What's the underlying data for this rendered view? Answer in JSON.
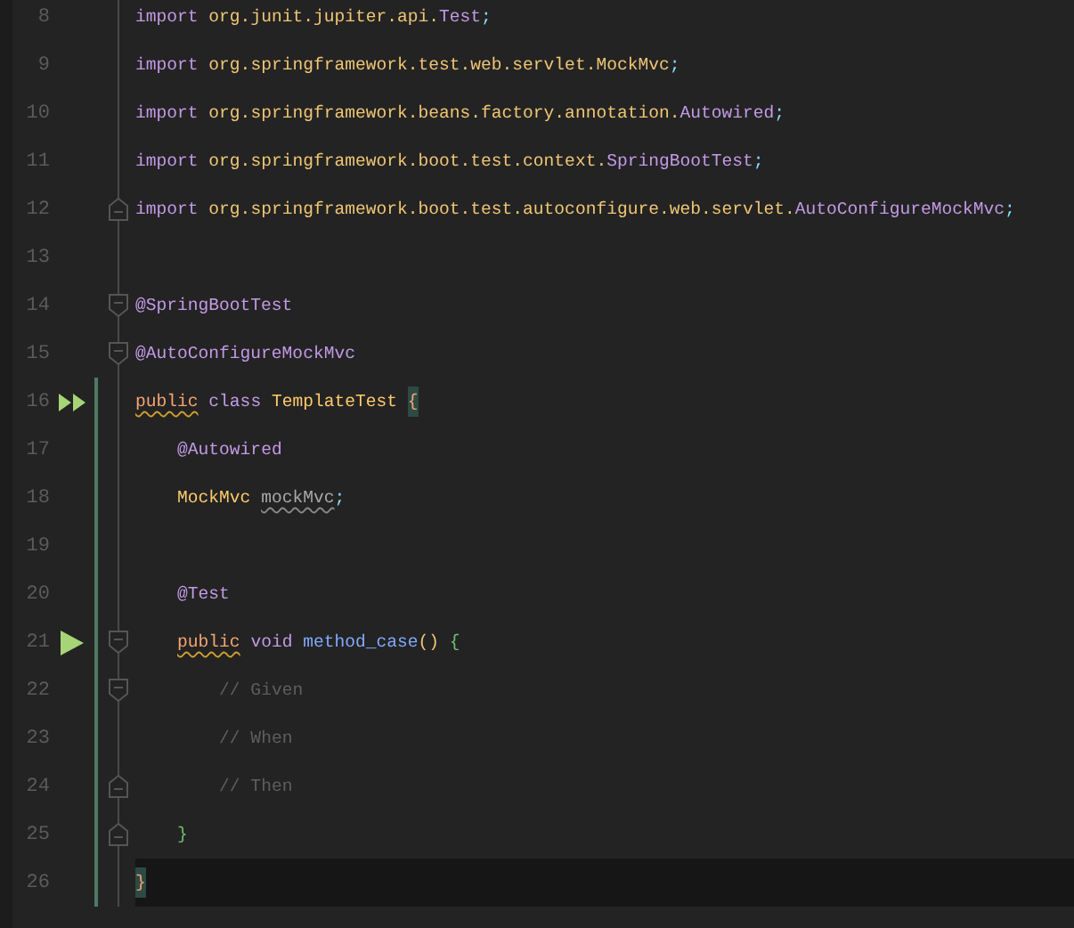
{
  "lines": [
    {
      "number": "8",
      "current": false,
      "changed": false,
      "tokens": [
        {
          "text": "import",
          "kind": "keyword"
        },
        {
          "text": " org.junit.jupiter.api.",
          "kind": "package"
        },
        {
          "text": "Test",
          "kind": "annotation"
        },
        {
          "text": ";",
          "kind": "punct"
        }
      ]
    },
    {
      "number": "9",
      "current": false,
      "changed": false,
      "tokens": [
        {
          "text": "import",
          "kind": "keyword"
        },
        {
          "text": " org.springframework.test.web.servlet.MockMvc",
          "kind": "package"
        },
        {
          "text": ";",
          "kind": "punct"
        }
      ]
    },
    {
      "number": "10",
      "current": false,
      "changed": false,
      "tokens": [
        {
          "text": "import",
          "kind": "keyword"
        },
        {
          "text": " org.springframework.beans.factory.annotation.",
          "kind": "package"
        },
        {
          "text": "Autowired",
          "kind": "annotation"
        },
        {
          "text": ";",
          "kind": "punct"
        }
      ]
    },
    {
      "number": "11",
      "current": false,
      "changed": false,
      "tokens": [
        {
          "text": "import",
          "kind": "keyword"
        },
        {
          "text": " org.springframework.boot.test.context.",
          "kind": "package"
        },
        {
          "text": "SpringBootTest",
          "kind": "annotation"
        },
        {
          "text": ";",
          "kind": "punct"
        }
      ]
    },
    {
      "number": "12",
      "current": false,
      "changed": false,
      "fold": {
        "kind": "end"
      },
      "tokens": [
        {
          "text": "import",
          "kind": "keyword"
        },
        {
          "text": " org.springframework.boot.test.autoconfigure.web.servlet.",
          "kind": "package"
        },
        {
          "text": "AutoConfigureMockMvc",
          "kind": "annotation"
        },
        {
          "text": ";",
          "kind": "punct"
        }
      ]
    },
    {
      "number": "13",
      "current": false,
      "changed": false
    },
    {
      "number": "14",
      "current": false,
      "changed": false,
      "fold": {
        "kind": "start"
      },
      "tokens": [
        {
          "text": "@SpringBootTest",
          "kind": "annotation"
        }
      ]
    },
    {
      "number": "15",
      "current": false,
      "changed": false,
      "fold": {
        "kind": "start"
      },
      "tokens": [
        {
          "text": "@AutoConfigureMockMvc",
          "kind": "annotation"
        }
      ]
    },
    {
      "number": "16",
      "current": false,
      "changed": true,
      "gutter_icon": {
        "kind": "run_all"
      },
      "tokens": [
        {
          "text": "public",
          "kind": "modifier",
          "warning": true
        },
        {
          "text": " class ",
          "kind": "keyword"
        },
        {
          "text": "TemplateTest ",
          "kind": "type"
        },
        {
          "text": "{",
          "kind": "brace",
          "matched": true
        }
      ]
    },
    {
      "number": "17",
      "current": false,
      "changed": true,
      "tokens": [
        {
          "text": "    @Autowired",
          "kind": "annotation"
        }
      ]
    },
    {
      "number": "18",
      "current": false,
      "changed": true,
      "tokens": [
        {
          "text": "    MockMvc ",
          "kind": "type"
        },
        {
          "text": "mockMvc",
          "kind": "field",
          "warning": true
        },
        {
          "text": ";",
          "kind": "punct"
        }
      ]
    },
    {
      "number": "19",
      "current": false,
      "changed": true
    },
    {
      "number": "20",
      "current": false,
      "changed": true,
      "tokens": [
        {
          "text": "    @Test",
          "kind": "annotation"
        }
      ]
    },
    {
      "number": "21",
      "current": false,
      "changed": true,
      "gutter_icon": {
        "kind": "run"
      },
      "fold": {
        "kind": "start"
      },
      "tokens": [
        {
          "text": "    public",
          "kind": "modifier",
          "warning": true
        },
        {
          "text": " void ",
          "kind": "keyword"
        },
        {
          "text": "method_case",
          "kind": "method"
        },
        {
          "text": "() ",
          "kind": "paren"
        },
        {
          "text": "{",
          "kind": "block"
        }
      ]
    },
    {
      "number": "22",
      "current": false,
      "changed": true,
      "fold": {
        "kind": "start"
      },
      "tokens": [
        {
          "text": "        // Given",
          "kind": "comment"
        }
      ]
    },
    {
      "number": "23",
      "current": false,
      "changed": true,
      "tokens": [
        {
          "text": "        // When",
          "kind": "comment"
        }
      ]
    },
    {
      "number": "24",
      "current": false,
      "changed": true,
      "fold": {
        "kind": "end"
      },
      "tokens": [
        {
          "text": "        // Then",
          "kind": "comment"
        }
      ]
    },
    {
      "number": "25",
      "current": false,
      "changed": true,
      "fold": {
        "kind": "end"
      },
      "tokens": [
        {
          "text": "    }",
          "kind": "block"
        }
      ]
    },
    {
      "number": "26",
      "current": true,
      "changed": true,
      "tokens": [
        {
          "text": "}",
          "kind": "brace",
          "matched": true
        }
      ]
    }
  ]
}
